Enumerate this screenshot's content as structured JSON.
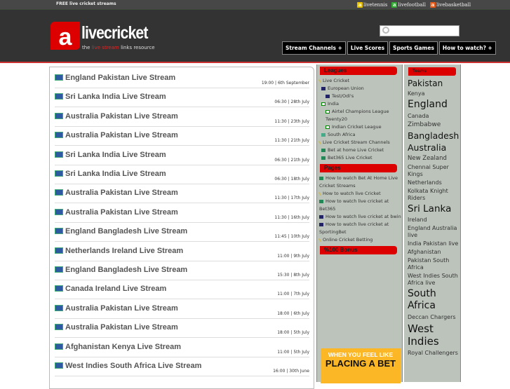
{
  "topbar": {
    "tagline": "FREE live cricket streams",
    "sites": [
      {
        "label": "livetennis",
        "color": "#e6c000"
      },
      {
        "label": "livefootball",
        "color": "#3a3"
      },
      {
        "label": "livebasketball",
        "color": "#e55a1a"
      }
    ]
  },
  "logo": {
    "mark": "a",
    "word": "livecricket",
    "tag_pre": "the",
    "tag_red": "live stream",
    "tag_post": "links resource"
  },
  "search": {
    "placeholder": ""
  },
  "nav": [
    "Stream Channels +",
    "Live Scores",
    "Sports Games",
    "How to watch? +"
  ],
  "streams": [
    {
      "title": "England Pakistan Live Stream",
      "date": "19:00 | 6th September"
    },
    {
      "title": "Sri Lanka India Live Stream",
      "date": "06:30 | 28th July"
    },
    {
      "title": "Australia Pakistan Live Stream",
      "date": "11:30 | 23th July"
    },
    {
      "title": "Australia Pakistan Live Stream",
      "date": "11:30 | 21th July"
    },
    {
      "title": "Sri Lanka India Live Stream",
      "date": "06:30 | 21th July"
    },
    {
      "title": "Sri Lanka India Live Stream",
      "date": "06:30 | 18th July"
    },
    {
      "title": "Australia Pakistan Live Stream",
      "date": "11:30 | 17th July"
    },
    {
      "title": "Australia Pakistan Live Stream",
      "date": "11:30 | 16th July"
    },
    {
      "title": "England Bangladesh Live Stream",
      "date": "11:45 | 10th July"
    },
    {
      "title": "Netherlands Ireland Live Stream",
      "date": "11:00 | 9th July"
    },
    {
      "title": "England Bangladesh Live Stream",
      "date": "15:30 | 8th July"
    },
    {
      "title": "Canada Ireland Live Stream",
      "date": "11:00 | 7th July"
    },
    {
      "title": "Australia Pakistan Live Stream",
      "date": "18:00 | 6th July"
    },
    {
      "title": "Australia Pakistan Live Stream",
      "date": "18:00 | 5th July"
    },
    {
      "title": "Afghanistan Kenya Live Stream",
      "date": "11:00 | 5th July"
    },
    {
      "title": "West Indies South Africa Live Stream",
      "date": "16:00 | 30th June"
    }
  ],
  "leagues": {
    "title": "Leagues",
    "items": [
      {
        "label": "Live Cricket",
        "icon": "bat",
        "level": 0
      },
      {
        "label": "European Union",
        "icon": "eu",
        "level": 1
      },
      {
        "label": "Test/Odi's",
        "icon": "eu",
        "level": 2
      },
      {
        "label": "India",
        "icon": "in",
        "level": 1
      },
      {
        "label": "Airtel Champions League Twenty20",
        "icon": "in",
        "level": 2
      },
      {
        "label": "Indian Cricket League",
        "icon": "in",
        "level": 2
      },
      {
        "label": "South Africa",
        "icon": "sa",
        "level": 1
      },
      {
        "label": "Live Cricket Stream Channels",
        "icon": "bat",
        "level": 0
      },
      {
        "label": "Bet at home Live Cricket",
        "icon": "bet",
        "level": 1
      },
      {
        "label": "Bet365 Live Cricket",
        "icon": "bet",
        "level": 1
      }
    ]
  },
  "pages": {
    "title": "Pages",
    "items": [
      {
        "label": "How to watch Bet At Home Live Cricket Streams",
        "icon": "bet"
      },
      {
        "label": "How to watch live Cricket",
        "icon": "bat"
      },
      {
        "label": "How to watch live cricket at Bet365",
        "icon": "bet"
      },
      {
        "label": "How to watch live cricket at bwin",
        "icon": "bwin"
      },
      {
        "label": "How to watch live cricket at SportingBet",
        "icon": "eu"
      },
      {
        "label": "Online Cricket Betting",
        "icon": "bat"
      }
    ]
  },
  "bonus": {
    "title": "%100 Bonus",
    "banner_top": "WHEN YOU FEEL LIKE",
    "banner_main": "PLACING A BET"
  },
  "teams": {
    "title": "Teams",
    "items": [
      {
        "label": "Pakistan",
        "size": 12
      },
      {
        "label": "Kenya",
        "size": 8
      },
      {
        "label": "England",
        "size": 14
      },
      {
        "label": "Canada",
        "size": 8
      },
      {
        "label": "Zimbabwe",
        "size": 9
      },
      {
        "label": "Bangladesh",
        "size": 12.5
      },
      {
        "label": "Australia",
        "size": 12.5
      },
      {
        "label": "New Zealand",
        "size": 8.5
      },
      {
        "label": "Chennai Super Kings",
        "size": 8
      },
      {
        "label": "Netherlands",
        "size": 8
      },
      {
        "label": "Kolkata Knight Riders",
        "size": 8
      },
      {
        "label": "Sri Lanka",
        "size": 13.5
      },
      {
        "label": "Ireland",
        "size": 8
      },
      {
        "label": "England Australia live",
        "size": 8
      },
      {
        "label": "India Pakistan live",
        "size": 8
      },
      {
        "label": "Afghanistan",
        "size": 8
      },
      {
        "label": "Pakistan South Africa",
        "size": 8
      },
      {
        "label": "West Indies South Africa live",
        "size": 8
      },
      {
        "label": "South Africa",
        "size": 14
      },
      {
        "label": "Deccan Chargers",
        "size": 8
      },
      {
        "label": "West Indies",
        "size": 15
      },
      {
        "label": "Royal Challengers",
        "size": 8
      }
    ]
  }
}
